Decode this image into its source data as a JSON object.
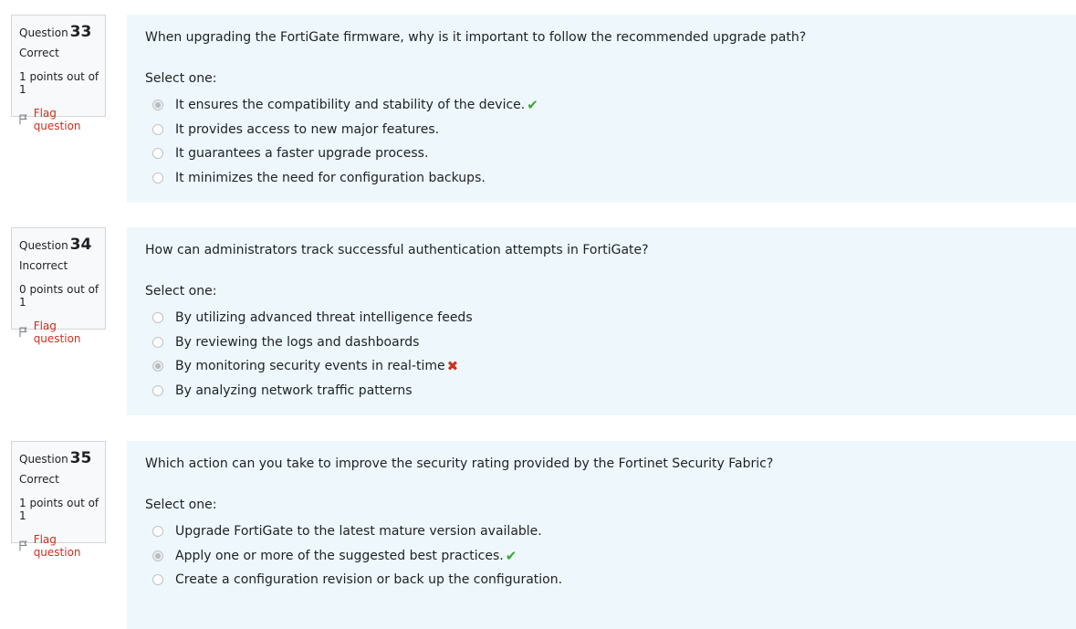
{
  "questions": [
    {
      "prefix": "Question",
      "number": "33",
      "state": "Correct",
      "grade": "1 points out of 1",
      "flag_label": "Flag question",
      "text": "When upgrading the FortiGate firmware, why is it important to follow the recommended upgrade path?",
      "prompt": "Select one:",
      "options": [
        {
          "label": "It ensures the compatibility and stability of the device.",
          "selected": true,
          "mark": "✔"
        },
        {
          "label": "It provides access to new major features.",
          "selected": false,
          "mark": ""
        },
        {
          "label": "It guarantees a faster upgrade process.",
          "selected": false,
          "mark": ""
        },
        {
          "label": "It minimizes the need for configuration backups.",
          "selected": false,
          "mark": ""
        }
      ]
    },
    {
      "prefix": "Question",
      "number": "34",
      "state": "Incorrect",
      "grade": "0 points out of 1",
      "flag_label": "Flag question",
      "text": "How can administrators track successful authentication attempts in FortiGate?",
      "prompt": "Select one:",
      "options": [
        {
          "label": "By utilizing advanced threat intelligence feeds",
          "selected": false,
          "mark": ""
        },
        {
          "label": "By reviewing the logs and dashboards",
          "selected": false,
          "mark": ""
        },
        {
          "label": "By monitoring security events in real-time",
          "selected": true,
          "mark": "✖"
        },
        {
          "label": "By analyzing network traffic patterns",
          "selected": false,
          "mark": ""
        }
      ]
    },
    {
      "prefix": "Question",
      "number": "35",
      "state": "Correct",
      "grade": "1 points out of 1",
      "flag_label": "Flag question",
      "text": "Which action can you take to improve the security rating provided by the Fortinet Security Fabric?",
      "prompt": "Select one:",
      "options": [
        {
          "label": "Upgrade FortiGate to the latest mature version available.",
          "selected": false,
          "mark": ""
        },
        {
          "label": "Apply one or more of the suggested best practices.",
          "selected": true,
          "mark": "✔"
        },
        {
          "label": "Create a configuration revision or back up the configuration.",
          "selected": false,
          "mark": ""
        }
      ]
    }
  ],
  "colors": {
    "flag": "#ca3120",
    "correct_mark": "#3fa33a",
    "incorrect_mark": "#ca3120",
    "content_bg": "#eef7fb",
    "info_bg": "#f8f9fa"
  },
  "icons": {
    "flag": "flag-icon",
    "correct": "check-icon",
    "incorrect": "cross-icon"
  }
}
